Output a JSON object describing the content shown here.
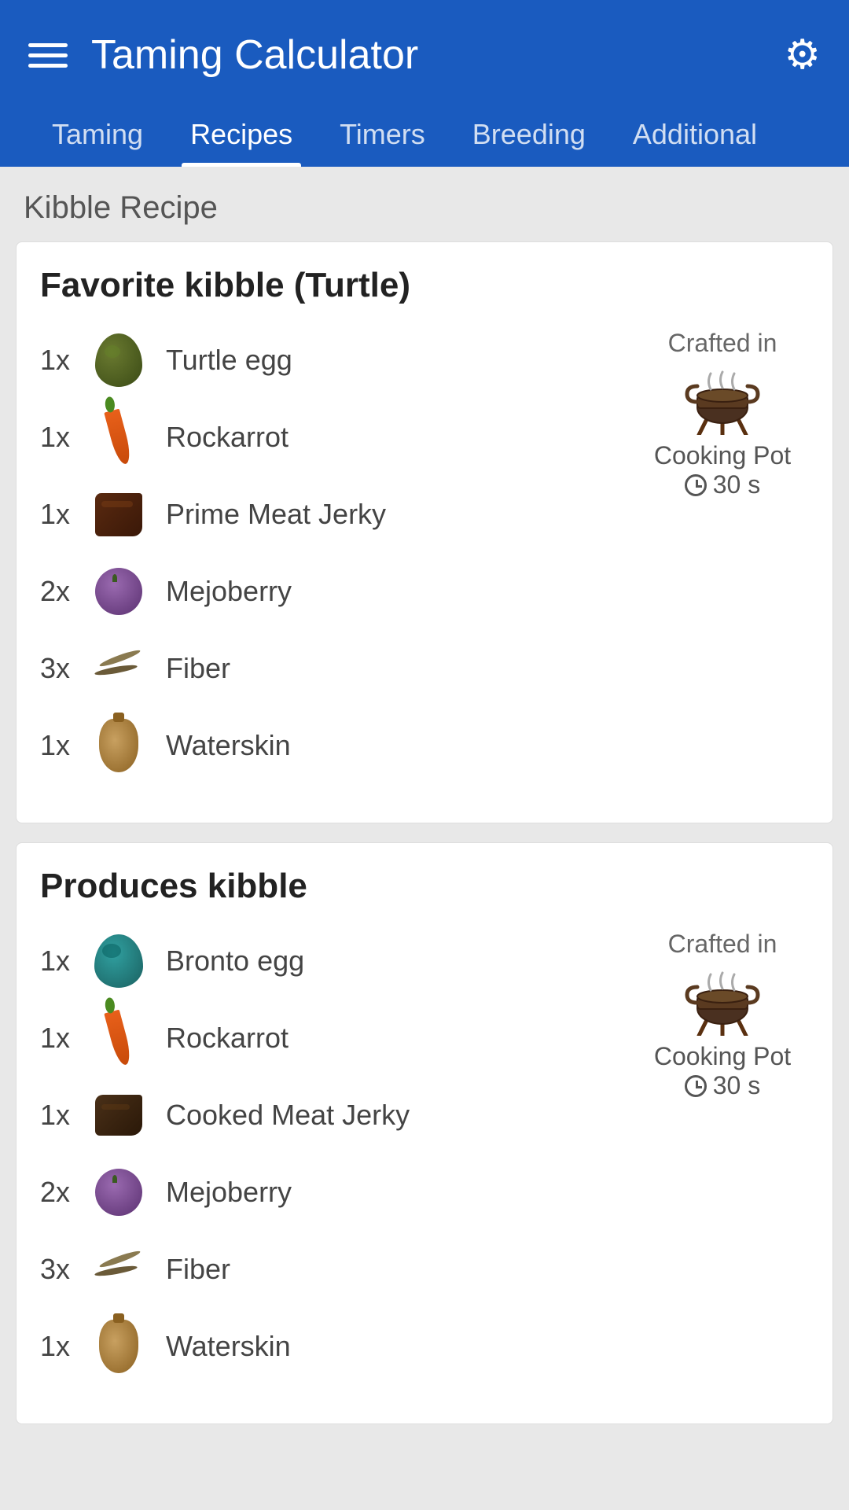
{
  "header": {
    "title": "Taming Calculator",
    "tabs": [
      {
        "id": "taming",
        "label": "Taming",
        "active": false
      },
      {
        "id": "recipes",
        "label": "Recipes",
        "active": true
      },
      {
        "id": "timers",
        "label": "Timers",
        "active": false
      },
      {
        "id": "breeding",
        "label": "Breeding",
        "active": false
      },
      {
        "id": "additional",
        "label": "Additional",
        "active": false
      }
    ]
  },
  "section_title": "Kibble Recipe",
  "recipe1": {
    "title": "Favorite kibble (Turtle)",
    "ingredients": [
      {
        "qty": "1x",
        "name": "Turtle egg",
        "icon": "turtle-egg-icon"
      },
      {
        "qty": "1x",
        "name": "Rockarrot",
        "icon": "rockarrot-icon"
      },
      {
        "qty": "1x",
        "name": "Prime Meat Jerky",
        "icon": "prime-meat-jerky-icon"
      },
      {
        "qty": "2x",
        "name": "Mejoberry",
        "icon": "mejoberry-icon"
      },
      {
        "qty": "3x",
        "name": "Fiber",
        "icon": "fiber-icon"
      },
      {
        "qty": "1x",
        "name": "Waterskin",
        "icon": "waterskin-icon"
      }
    ],
    "crafted_in_label": "Crafted in",
    "crafting_place": "Cooking Pot",
    "crafting_time": "30 s"
  },
  "recipe2": {
    "title": "Produces kibble",
    "ingredients": [
      {
        "qty": "1x",
        "name": "Bronto egg",
        "icon": "bronto-egg-icon"
      },
      {
        "qty": "1x",
        "name": "Rockarrot",
        "icon": "rockarrot-icon"
      },
      {
        "qty": "1x",
        "name": "Cooked Meat Jerky",
        "icon": "cooked-meat-jerky-icon"
      },
      {
        "qty": "2x",
        "name": "Mejoberry",
        "icon": "mejoberry-icon"
      },
      {
        "qty": "3x",
        "name": "Fiber",
        "icon": "fiber-icon"
      },
      {
        "qty": "1x",
        "name": "Waterskin",
        "icon": "waterskin-icon"
      }
    ],
    "crafted_in_label": "Crafted in",
    "crafting_place": "Cooking Pot",
    "crafting_time": "30 s"
  }
}
